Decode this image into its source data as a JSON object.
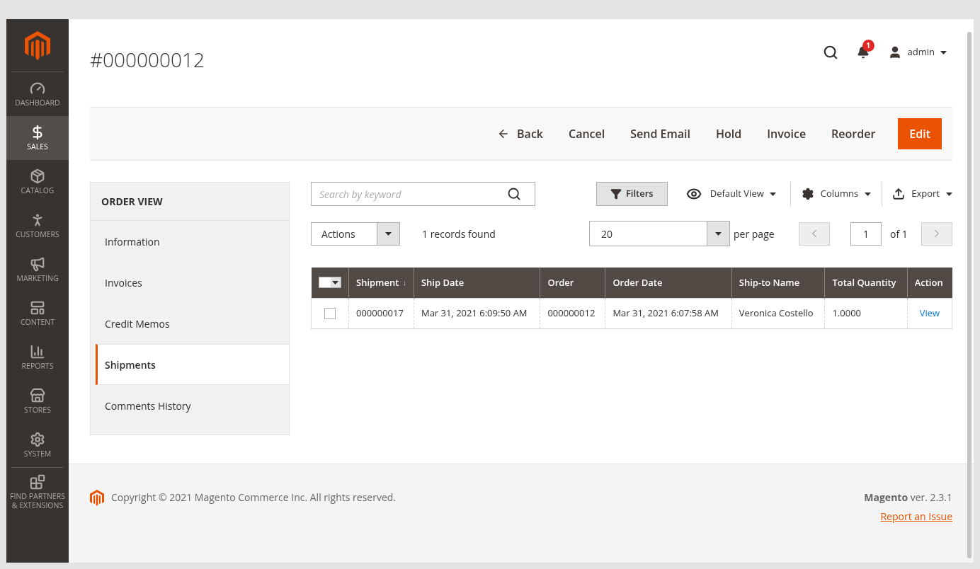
{
  "sidebar": {
    "items": [
      {
        "label": "DASHBOARD",
        "selected": false
      },
      {
        "label": "SALES",
        "selected": true
      },
      {
        "label": "CATALOG",
        "selected": false
      },
      {
        "label": "CUSTOMERS",
        "selected": false
      },
      {
        "label": "MARKETING",
        "selected": false
      },
      {
        "label": "CONTENT",
        "selected": false
      },
      {
        "label": "REPORTS",
        "selected": false
      },
      {
        "label": "STORES",
        "selected": false
      },
      {
        "label": "SYSTEM",
        "selected": false
      },
      {
        "label": "FIND PARTNERS & EXTENSIONS",
        "selected": false
      }
    ]
  },
  "header": {
    "title": "#000000012",
    "notifications": "1",
    "user": "admin"
  },
  "actions": [
    {
      "label": "Back",
      "kind": "back"
    },
    {
      "label": "Cancel",
      "kind": "plain"
    },
    {
      "label": "Send Email",
      "kind": "plain"
    },
    {
      "label": "Hold",
      "kind": "plain"
    },
    {
      "label": "Invoice",
      "kind": "plain"
    },
    {
      "label": "Reorder",
      "kind": "plain"
    },
    {
      "label": "Edit",
      "kind": "primary"
    }
  ],
  "order_view": {
    "title": "ORDER VIEW",
    "tabs": [
      {
        "label": "Information",
        "selected": false
      },
      {
        "label": "Invoices",
        "selected": false
      },
      {
        "label": "Credit Memos",
        "selected": false
      },
      {
        "label": "Shipments",
        "selected": true
      },
      {
        "label": "Comments History",
        "selected": false
      }
    ]
  },
  "grid": {
    "search": {
      "placeholder": "Search by keyword"
    },
    "filters": "Filters",
    "view": "Default View",
    "columns_menu": "Columns",
    "export": "Export",
    "mass_action": "Actions",
    "records": "1 records found",
    "per_page": "20",
    "per_page_label": "per page",
    "page": "1",
    "page_total": "of 1",
    "columns": [
      {
        "label": "Shipment",
        "sort_indicator": "↓"
      },
      {
        "label": "Ship Date"
      },
      {
        "label": "Order"
      },
      {
        "label": "Order Date"
      },
      {
        "label": "Ship-to Name"
      },
      {
        "label": "Total Quantity"
      },
      {
        "label": "Action"
      }
    ],
    "rows": [
      {
        "checked": false,
        "cells": [
          "000000017",
          "Mar 31, 2021 6:09:50 AM",
          "000000012",
          "Mar 31, 2021 6:07:58 AM",
          "Veronica Costello",
          "1.0000"
        ],
        "action": "View"
      }
    ]
  },
  "footer": {
    "copyright": "Copyright © 2021 Magento Commerce Inc. All rights reserved.",
    "version": "**Magento** ver. 2.3.1",
    "report": "Report an Issue"
  }
}
